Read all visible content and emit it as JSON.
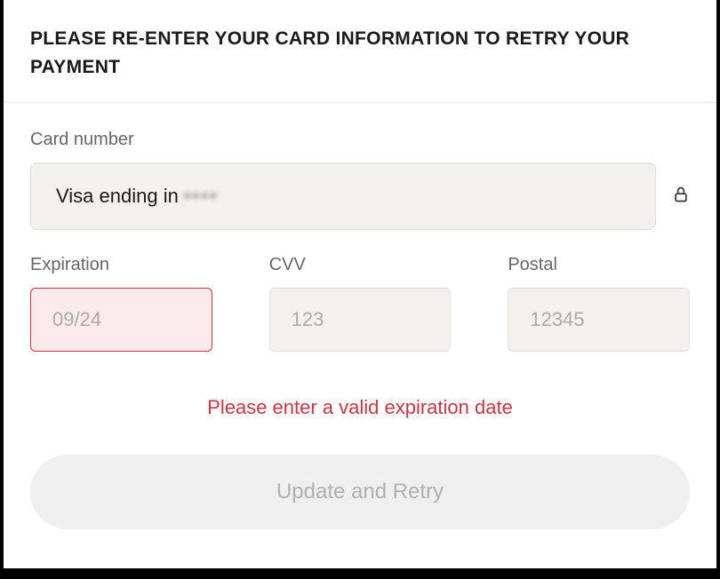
{
  "header": {
    "title": "PLEASE RE-ENTER YOUR CARD INFORMATION TO RETRY YOUR PAYMENT"
  },
  "card": {
    "label": "Card number",
    "prefix": "Visa ending in",
    "masked": "••••"
  },
  "expiration": {
    "label": "Expiration",
    "placeholder": "09/24",
    "value": ""
  },
  "cvv": {
    "label": "CVV",
    "placeholder": "123",
    "value": ""
  },
  "postal": {
    "label": "Postal",
    "placeholder": "12345",
    "value": ""
  },
  "error_message": "Please enter a valid expiration date",
  "submit_label": "Update and Retry"
}
